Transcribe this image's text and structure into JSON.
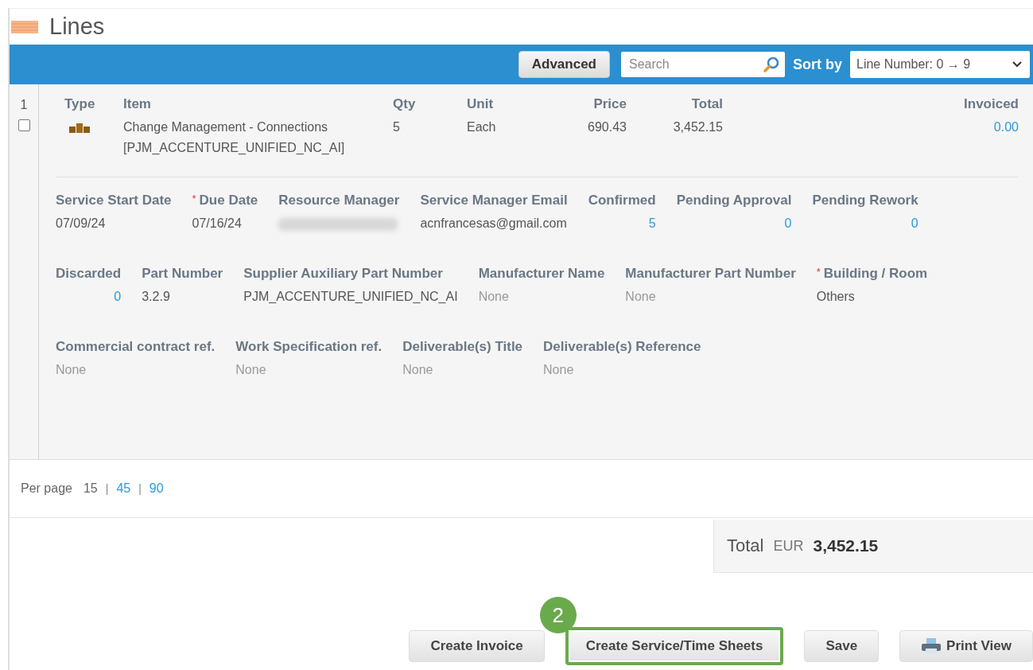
{
  "section_title": "Lines",
  "toolbar": {
    "advanced_button": "Advanced",
    "search": {
      "placeholder": "Search"
    },
    "sort_label": "Sort by",
    "sort_value": "Line Number: 0 → 9"
  },
  "line": {
    "number": "1",
    "checked": false,
    "columns": [
      {
        "label": "Type"
      },
      {
        "label": "Item"
      },
      {
        "label": "Qty"
      },
      {
        "label": "Unit"
      },
      {
        "label": "Price"
      },
      {
        "label": "Total"
      },
      {
        "label": "Invoiced"
      }
    ],
    "item_lines": [
      "Change Management - Connections",
      "[PJM_ACCENTURE_UNIFIED_NC_AI]"
    ],
    "qty": "5",
    "unit": "Each",
    "price": "690.43",
    "total": "3,452.15",
    "invoiced": "0.00",
    "detail_rows": [
      [
        {
          "label": "Service Start Date",
          "kind": "text",
          "value": "07/09/24"
        },
        {
          "required_mark": "*",
          "label": "Due Date",
          "kind": "text",
          "value": "07/16/24"
        },
        {
          "label": "Resource Manager",
          "kind": "redacted"
        },
        {
          "label": "Service Manager Email",
          "kind": "text",
          "value": "acnfrancesas@gmail.com"
        },
        {
          "label": "Confirmed",
          "kind": "link",
          "value": "5"
        },
        {
          "label": "Pending Approval",
          "kind": "link",
          "value": "0"
        },
        {
          "label": "Pending Rework",
          "kind": "link",
          "value": "0"
        }
      ],
      [
        {
          "label": "Discarded",
          "kind": "link",
          "value": "0"
        },
        {
          "label": "Part Number",
          "kind": "text",
          "value": "3.2.9"
        },
        {
          "label": "Supplier Auxiliary Part Number",
          "kind": "text",
          "value": "PJM_ACCENTURE_UNIFIED_NC_AI"
        },
        {
          "label": "Manufacturer Name",
          "kind": "none",
          "value": "None"
        },
        {
          "label": "Manufacturer Part Number",
          "kind": "none",
          "value": "None"
        },
        {
          "required_mark": "*",
          "label": "Building / Room",
          "kind": "text",
          "value": "Others"
        }
      ],
      [
        {
          "label": "Commercial contract ref.",
          "kind": "none",
          "value": "None"
        },
        {
          "label": "Work Specification ref.",
          "kind": "none",
          "value": "None"
        },
        {
          "label": "Deliverable(s) Title",
          "kind": "none",
          "value": "None"
        },
        {
          "label": "Deliverable(s) Reference",
          "kind": "none",
          "value": "None"
        }
      ]
    ]
  },
  "per_page": {
    "label": "Per page",
    "options": [
      {
        "value": "15",
        "selected": true
      },
      {
        "separator": "|",
        "value": "45",
        "selected": false
      },
      {
        "separator": "|",
        "value": "90",
        "selected": false
      }
    ]
  },
  "summary": {
    "label": "Total",
    "currency": "EUR",
    "amount": "3,452.15"
  },
  "actions": [
    {
      "label": "Create Invoice",
      "highlighted": false,
      "kind": "plain"
    },
    {
      "label": "Create Service/Time Sheets",
      "highlighted": true,
      "step": "2",
      "kind": "plain"
    },
    {
      "label": "Save",
      "highlighted": false,
      "kind": "plain"
    },
    {
      "label": "Print View",
      "highlighted": false,
      "kind": "print"
    }
  ]
}
